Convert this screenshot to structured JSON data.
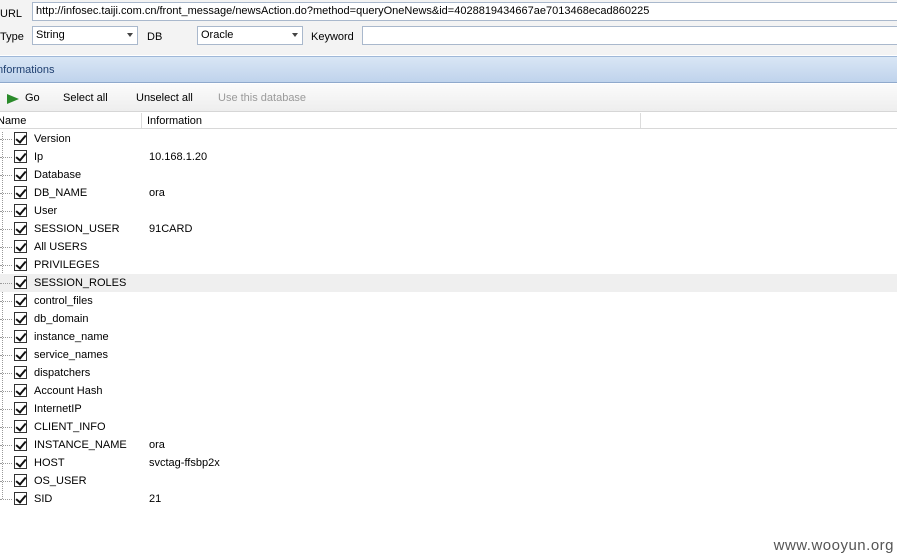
{
  "form": {
    "url_label": "URL",
    "url_value": "http://infosec.taiji.com.cn/front_message/newsAction.do?method=queryOneNews&id=4028819434667ae7013468ecad860225",
    "type_label": "Type",
    "type_value": "String",
    "db_label": "DB",
    "db_value": "Oracle",
    "keyword_label": "Keyword",
    "keyword_value": ""
  },
  "section": {
    "title": "Informations"
  },
  "toolbar": {
    "go_label": "Go",
    "select_all_label": "Select all",
    "unselect_all_label": "Unselect all",
    "use_db_label": "Use this database"
  },
  "table": {
    "col_name": "Name",
    "col_info": "Information",
    "rows": [
      {
        "name": "Version",
        "info": ""
      },
      {
        "name": "Ip",
        "info": "10.168.1.20"
      },
      {
        "name": "Database",
        "info": ""
      },
      {
        "name": "DB_NAME",
        "info": "ora"
      },
      {
        "name": "User",
        "info": ""
      },
      {
        "name": "SESSION_USER",
        "info": "91CARD"
      },
      {
        "name": "All USERS",
        "info": ""
      },
      {
        "name": "PRIVILEGES",
        "info": ""
      },
      {
        "name": "SESSION_ROLES",
        "info": ""
      },
      {
        "name": "control_files",
        "info": ""
      },
      {
        "name": "db_domain",
        "info": ""
      },
      {
        "name": "instance_name",
        "info": ""
      },
      {
        "name": "service_names",
        "info": ""
      },
      {
        "name": "dispatchers",
        "info": ""
      },
      {
        "name": "Account Hash",
        "info": ""
      },
      {
        "name": "InternetIP",
        "info": ""
      },
      {
        "name": "CLIENT_INFO",
        "info": ""
      },
      {
        "name": "INSTANCE_NAME",
        "info": "ora"
      },
      {
        "name": "HOST",
        "info": "svctag-ffsbp2x"
      },
      {
        "name": "OS_USER",
        "info": ""
      },
      {
        "name": "SID",
        "info": "21"
      }
    ]
  },
  "watermark": "www.wooyun.org",
  "colors": {
    "section_bg": "#c9dbf0",
    "highlight_row": "#efefef",
    "go_icon": "#2a8a2a"
  }
}
